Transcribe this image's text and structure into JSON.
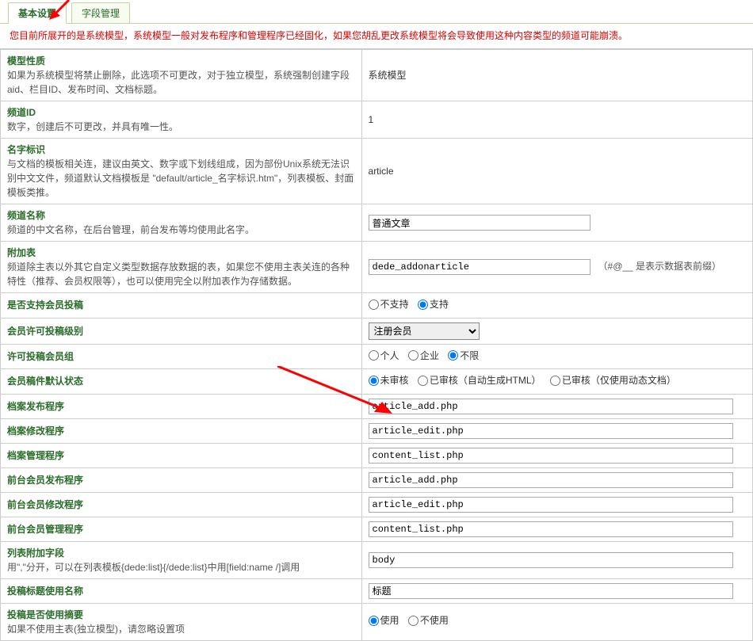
{
  "tabs": {
    "basic": "基本设置",
    "fields": "字段管理"
  },
  "warning": "您目前所展开的是系统模型，系统模型一般对发布程序和管理程序已经固化，如果您胡乱更改系统模型将会导致使用这种内容类型的频道可能崩溃。",
  "rows": {
    "nature": {
      "title": "模型性质",
      "desc": "如果为系统模型将禁止删除，此选项不可更改，对于独立模型，系统强制创建字段aid、栏目ID、发布时间、文档标题。",
      "value": "系统模型"
    },
    "cid": {
      "title": "频道ID",
      "desc": "数字，创建后不可更改，并具有唯一性。",
      "value": "1"
    },
    "nid": {
      "title": "名字标识",
      "desc": "与文档的模板相关连，建议由英文、数字或下划线组成，因为部份Unix系统无法识别中文文件，频道默认文档模板是 \"default/article_名字标识.htm\"，列表模板、封面模板类推。",
      "value": "article"
    },
    "cname": {
      "title": "频道名称",
      "desc": "频道的中文名称，在后台管理，前台发布等均使用此名字。",
      "value": "普通文章"
    },
    "addtable": {
      "title": "附加表",
      "desc": "频道除主表以外其它自定义类型数据存放数据的表，如果您不使用主表关连的各种特性（推荐、会员权限等），也可以使用完全以附加表作为存储数据。",
      "value": "dede_addonarticle",
      "hint": "（#@__ 是表示数据表前缀）"
    },
    "issend": {
      "title": "是否支持会员投稿",
      "opts": [
        "不支持",
        "支持"
      ],
      "checked": 1
    },
    "arcrank": {
      "title": "会员许可投稿级别",
      "value": "注册会员"
    },
    "usertype": {
      "title": "许可投稿会员组",
      "opts": [
        "个人",
        "企业",
        "不限"
      ],
      "checked": 2
    },
    "draft": {
      "title": "会员稿件默认状态",
      "opts": [
        "未审核",
        "已审核（自动生成HTML）",
        "已审核（仅使用动态文档）"
      ],
      "checked": 0
    },
    "addcon": {
      "title": "档案发布程序",
      "value": "article_add.php"
    },
    "editcon": {
      "title": "档案修改程序",
      "value": "article_edit.php"
    },
    "mancon": {
      "title": "档案管理程序",
      "value": "content_list.php"
    },
    "uaddcon": {
      "title": "前台会员发布程序",
      "value": "article_add.php"
    },
    "ueditcon": {
      "title": "前台会员修改程序",
      "value": "article_edit.php"
    },
    "umancon": {
      "title": "前台会员管理程序",
      "value": "content_list.php"
    },
    "listfields": {
      "title": "列表附加字段",
      "desc": "用\",\"分开，可以在列表模板{dede:list}{/dede:list}中用[field:name /]调用",
      "value": "body"
    },
    "titlename": {
      "title": "投稿标题使用名称",
      "value": "标题"
    },
    "usedesc": {
      "title": "投稿是否使用摘要",
      "desc": "如果不使用主表(独立模型)，请忽略设置项",
      "opts": [
        "使用",
        "不使用"
      ],
      "checked": 0
    }
  }
}
